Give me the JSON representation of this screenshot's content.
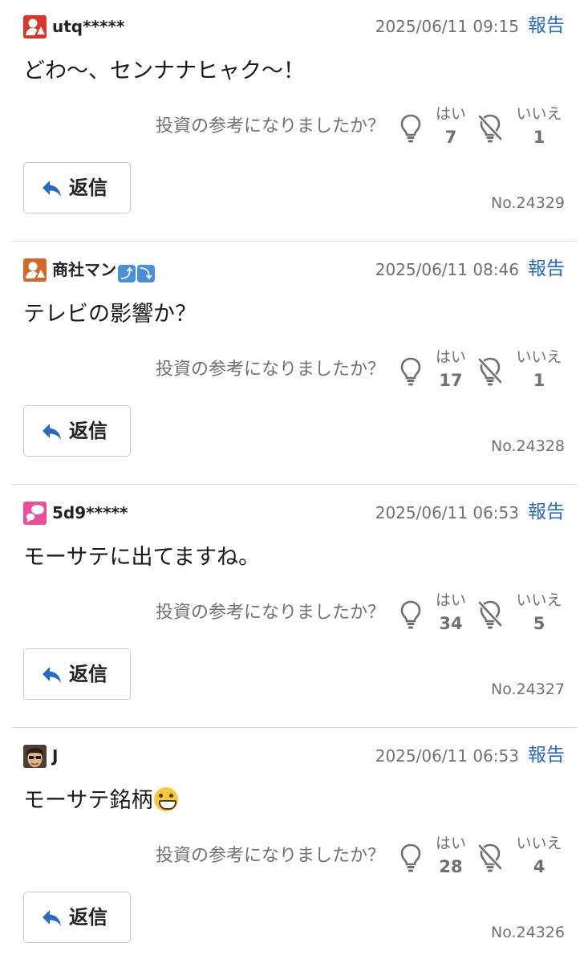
{
  "question_text": "投資の参考になりましたか？",
  "yes_label": "はい",
  "no_label": "いいえ",
  "reply_label": "返信",
  "report_label": "報告",
  "posts": [
    {
      "avatar": "red-user-avatar",
      "avatar_color": "#d7372b",
      "username": "utq*****",
      "username_emoji": [],
      "datetime": "2025/06/11 09:15",
      "text": "どわ〜、センナナヒャク〜！",
      "text_emoji": "",
      "yes_count": "7",
      "no_count": "1",
      "post_no": "No.24329"
    },
    {
      "avatar": "orange-user-avatar",
      "avatar_color": "#d2692c",
      "username": "商社マン",
      "username_emoji": [
        "⤴",
        "⤵"
      ],
      "datetime": "2025/06/11 08:46",
      "text": "テレビの影響か？",
      "text_emoji": "",
      "yes_count": "17",
      "no_count": "1",
      "post_no": "No.24328"
    },
    {
      "avatar": "pink-speech-avatar",
      "avatar_color": "#e8509c",
      "username": "5d9*****",
      "username_emoji": [],
      "datetime": "2025/06/11 06:53",
      "text": "モーサテに出てますね。",
      "text_emoji": "",
      "yes_count": "34",
      "no_count": "5",
      "post_no": "No.24327"
    },
    {
      "avatar": "photo-face-avatar",
      "avatar_color": "#3a3028",
      "username": "J",
      "username_emoji": [],
      "datetime": "2025/06/11 06:53",
      "text": "モーサテ銘柄",
      "text_emoji": "grinning-face",
      "yes_count": "28",
      "no_count": "4",
      "post_no": "No.24326"
    }
  ],
  "colors": {
    "link_blue": "#2a6ab8",
    "muted_gray": "#707070",
    "reply_arrow": "#2a6ab8"
  }
}
